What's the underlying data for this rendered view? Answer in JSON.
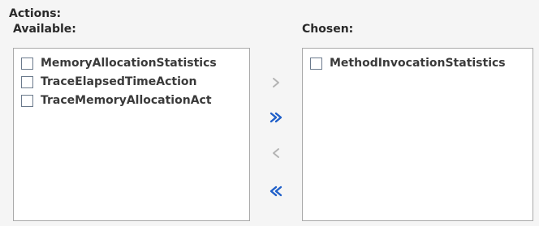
{
  "section": {
    "title": "Actions:"
  },
  "available": {
    "label": "Available:",
    "items": [
      {
        "label": "MemoryAllocationStatistics",
        "checked": false
      },
      {
        "label": "TraceElapsedTimeAction",
        "checked": false
      },
      {
        "label": "TraceMemoryAllocationAct",
        "checked": false
      }
    ]
  },
  "chosen": {
    "label": "Chosen:",
    "items": [
      {
        "label": "MethodInvocationStatistics",
        "checked": false
      }
    ]
  },
  "shuttle": {
    "move_right": {
      "icon": "chevron-right-icon",
      "enabled": false
    },
    "move_all_right": {
      "icon": "double-chevron-right-icon",
      "enabled": true
    },
    "move_left": {
      "icon": "chevron-left-icon",
      "enabled": false
    },
    "move_all_left": {
      "icon": "double-chevron-left-icon",
      "enabled": true
    }
  },
  "colors": {
    "enabled_arrow": "#1f5fc9",
    "disabled_arrow": "#b4b4b4",
    "list_border": "#a9a9a9",
    "background": "#f5f5f5"
  }
}
